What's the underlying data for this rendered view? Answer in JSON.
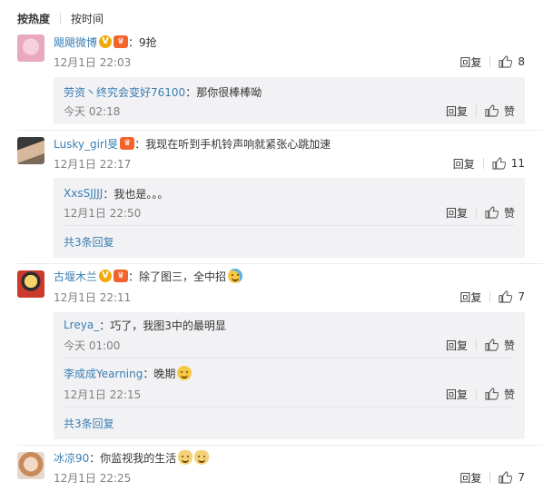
{
  "sort": {
    "hot": "按热度",
    "time": "按时间"
  },
  "comments": [
    {
      "user": "飓飓微博",
      "text": "：9抢",
      "time": "12月1日 22:03",
      "reply_label": "回复",
      "likes": "8",
      "replies": [
        {
          "user": "劳资丶终究会变好76100",
          "text": "：那你很棒棒呦",
          "time": "今天 02:18",
          "reply_label": "回复",
          "like_label": "赞"
        }
      ]
    },
    {
      "user": "Lusky_girl旻",
      "text": "：我现在听到手机铃声响就紧张心跳加速",
      "time": "12月1日 22:17",
      "reply_label": "回复",
      "likes": "11",
      "replies": [
        {
          "user": "XxsSJJJJ",
          "text": "：我也是。。。",
          "time": "12月1日 22:50",
          "reply_label": "回复",
          "like_label": "赞"
        }
      ],
      "more": "共3条回复"
    },
    {
      "user": "古堰木兰",
      "text": "：除了图三，全中招",
      "time": "12月1日 22:11",
      "reply_label": "回复",
      "likes": "7",
      "replies": [
        {
          "user": "Lreya_",
          "text": "：巧了，我图3中的最明显",
          "time": "今天 01:00",
          "reply_label": "回复",
          "like_label": "赞"
        },
        {
          "user": "李成成Yearning",
          "text": "：晚期",
          "time": "12月1日 22:15",
          "reply_label": "回复",
          "like_label": "赞"
        }
      ],
      "more": "共3条回复"
    },
    {
      "user": "冰凉90",
      "text": "：你监视我的生活",
      "time": "12月1日 22:25",
      "reply_label": "回复",
      "likes": "7"
    }
  ],
  "icons": [
    "v-badge-icon",
    "vip-badge-icon",
    "thumbs-up-icon",
    "emoji-icon"
  ],
  "colors": {
    "link": "#3b7fb3",
    "reply_bg": "#f2f2f5",
    "meta": "#808080"
  }
}
